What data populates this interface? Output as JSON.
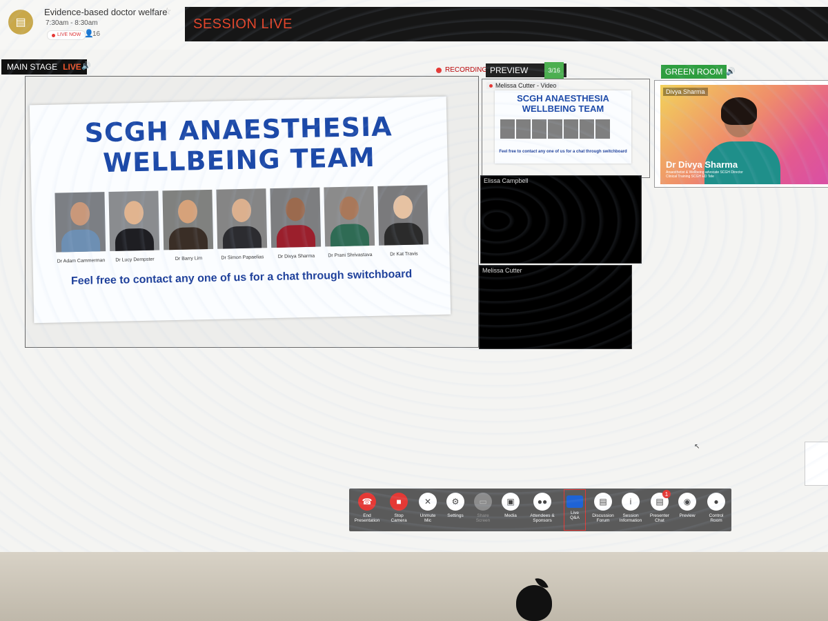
{
  "event": {
    "title": "Evidence-based doctor welfare",
    "time": "7:30am - 8:30am",
    "live_badge": "LIVE NOW",
    "attendee_count": "16"
  },
  "session": {
    "status": "SESSION LIVE"
  },
  "main_stage": {
    "label": "MAIN STAGE",
    "live": "LIVE",
    "recording": "RECORDING",
    "slide": {
      "title_line1": "SCGH ANAESTHESIA",
      "title_line2": "WELLBEING TEAM",
      "people": [
        {
          "name": "Dr Adam Cammerman"
        },
        {
          "name": "Dr Lucy Dempster"
        },
        {
          "name": "Dr Barry Lim"
        },
        {
          "name": "Dr Simon Papaelias"
        },
        {
          "name": "Dr Divya Sharma"
        },
        {
          "name": "Dr Prani Shrivastava"
        },
        {
          "name": "Dr Kat Travis"
        }
      ],
      "footer": "Feel free to contact any one of us for a chat through switchboard"
    }
  },
  "preview": {
    "label": "PREVIEW",
    "counter": "3/16",
    "source": "Melissa Cutter - Video",
    "slide_title": "SCGH ANAESTHESIA WELLBEING TEAM",
    "slide_footer": "Feel free to contact any one of us for a chat through switchboard"
  },
  "video_tiles": [
    {
      "name": "Elissa Campbell"
    },
    {
      "name": "Melissa Cutter"
    }
  ],
  "green_room": {
    "label": "GREEN ROOM",
    "participant": "Divya Sharma",
    "overlay_name": "Dr Divya Sharma",
    "overlay_sub": "Anaesthetist & Wellbeing advocate SCGH Director Clinical Training SCGH ED Tele"
  },
  "toolbar": [
    {
      "label": "End\nPresentation",
      "icon": "phone-hangup-icon",
      "glyph": "☎"
    },
    {
      "label": "Stop\nCamera",
      "icon": "camera-off-icon",
      "glyph": "■"
    },
    {
      "label": "Unmute\nMic",
      "icon": "mic-muted-icon",
      "glyph": "🎙"
    },
    {
      "label": "Settings",
      "icon": "gear-icon",
      "glyph": "⚙"
    },
    {
      "label": "Share\nScreen",
      "icon": "share-screen-icon",
      "glyph": "▭"
    },
    {
      "label": "Media",
      "icon": "media-icon",
      "glyph": "▣"
    },
    {
      "label": "Attendees &\nSponsors",
      "icon": "people-icon",
      "glyph": "👥"
    },
    {
      "label": "Live\nQ&A",
      "icon": "qa-icon",
      "glyph": ""
    },
    {
      "label": "Discussion\nForum",
      "icon": "forum-icon",
      "glyph": "💬"
    },
    {
      "label": "Session\nInformation",
      "icon": "info-icon",
      "glyph": "ⓘ"
    },
    {
      "label": "Presenter\nChat",
      "icon": "chat-icon",
      "glyph": "💬",
      "badge": "1"
    },
    {
      "label": "Preview",
      "icon": "eye-icon",
      "glyph": "◉"
    },
    {
      "label": "Control\nRoom",
      "icon": "user-icon",
      "glyph": "●"
    }
  ],
  "colors": {
    "live_red": "#e2452b",
    "green_room": "#2e9e3f",
    "slide_blue": "#1c49a8",
    "toolbar_bg": "#5a5a5a"
  }
}
